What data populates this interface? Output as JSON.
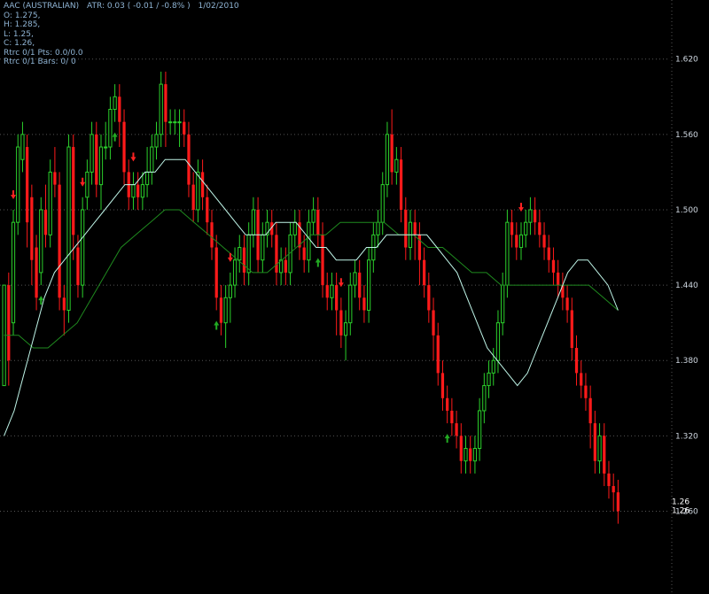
{
  "header": {
    "symbol": "AAC (AUSTRALIAN)",
    "atr": "ATR: 0.03 ( -0.01 / -0.8% )",
    "date": "1/02/2010",
    "open": "O: 1.275,",
    "high": "H: 1.285,",
    "low": "L: 1.25,",
    "close": "C: 1.26,",
    "rtrc_pts": "Rtrc 0/1 Pts: 0.0/0.0",
    "rtrc_bars": "Rtrc 0/1 Bars:  0/ 0"
  },
  "colors": {
    "background": "#000000",
    "up_candle": "#2bd12b",
    "down_candle": "#ff1a1a",
    "fast_ma": "#bff5e8",
    "slow_ma": "#1f8a1f",
    "grid": "#555555",
    "up_arrow": "#22aa22",
    "down_arrow": "#ff2222"
  },
  "chart_data": {
    "type": "candlestick",
    "title": "AAC (AUSTRALIAN)",
    "ylim": [
      1.23,
      1.66
    ],
    "y_ticks": [
      "1.620",
      "1.560",
      "1.500",
      "1.440",
      "1.380",
      "1.320",
      "1.260"
    ],
    "last_labels": [
      "1.26",
      "1.26"
    ],
    "grid": true,
    "candles": [
      [
        1.36,
        1.44,
        1.37,
        1.43
      ],
      [
        1.44,
        1.38,
        1.36,
        1.45
      ],
      [
        1.41,
        1.49,
        1.4,
        1.5
      ],
      [
        1.49,
        1.55,
        1.48,
        1.56
      ],
      [
        1.54,
        1.56,
        1.53,
        1.57
      ],
      [
        1.55,
        1.49,
        1.47,
        1.56
      ],
      [
        1.51,
        1.46,
        1.44,
        1.52
      ],
      [
        1.47,
        1.43,
        1.42,
        1.48
      ],
      [
        1.45,
        1.5,
        1.44,
        1.51
      ],
      [
        1.5,
        1.48,
        1.47,
        1.52
      ],
      [
        1.48,
        1.53,
        1.47,
        1.54
      ],
      [
        1.53,
        1.52,
        1.51,
        1.55
      ],
      [
        1.52,
        1.43,
        1.42,
        1.53
      ],
      [
        1.43,
        1.42,
        1.4,
        1.44
      ],
      [
        1.42,
        1.55,
        1.41,
        1.56
      ],
      [
        1.55,
        1.48,
        1.46,
        1.56
      ],
      [
        1.47,
        1.44,
        1.43,
        1.48
      ],
      [
        1.44,
        1.5,
        1.43,
        1.51
      ],
      [
        1.51,
        1.53,
        1.5,
        1.54
      ],
      [
        1.53,
        1.56,
        1.52,
        1.57
      ],
      [
        1.56,
        1.52,
        1.51,
        1.57
      ],
      [
        1.52,
        1.55,
        1.5,
        1.56
      ],
      [
        1.55,
        1.55,
        1.54,
        1.57
      ],
      [
        1.55,
        1.58,
        1.54,
        1.59
      ],
      [
        1.58,
        1.59,
        1.57,
        1.6
      ],
      [
        1.59,
        1.57,
        1.55,
        1.6
      ],
      [
        1.57,
        1.53,
        1.52,
        1.58
      ],
      [
        1.53,
        1.51,
        1.5,
        1.54
      ],
      [
        1.51,
        1.52,
        1.5,
        1.53
      ],
      [
        1.52,
        1.51,
        1.5,
        1.53
      ],
      [
        1.51,
        1.52,
        1.5,
        1.53
      ],
      [
        1.52,
        1.53,
        1.51,
        1.55
      ],
      [
        1.53,
        1.55,
        1.52,
        1.56
      ],
      [
        1.55,
        1.56,
        1.54,
        1.57
      ],
      [
        1.56,
        1.6,
        1.55,
        1.61
      ],
      [
        1.6,
        1.57,
        1.55,
        1.61
      ],
      [
        1.57,
        1.57,
        1.56,
        1.58
      ],
      [
        1.57,
        1.57,
        1.56,
        1.58
      ],
      [
        1.57,
        1.57,
        1.55,
        1.58
      ],
      [
        1.57,
        1.56,
        1.55,
        1.58
      ],
      [
        1.56,
        1.52,
        1.51,
        1.57
      ],
      [
        1.52,
        1.5,
        1.49,
        1.53
      ],
      [
        1.5,
        1.53,
        1.49,
        1.54
      ],
      [
        1.53,
        1.51,
        1.5,
        1.54
      ],
      [
        1.51,
        1.49,
        1.48,
        1.52
      ],
      [
        1.49,
        1.47,
        1.46,
        1.5
      ],
      [
        1.47,
        1.43,
        1.42,
        1.48
      ],
      [
        1.43,
        1.41,
        1.4,
        1.44
      ],
      [
        1.41,
        1.43,
        1.39,
        1.44
      ],
      [
        1.43,
        1.44,
        1.41,
        1.45
      ],
      [
        1.44,
        1.46,
        1.43,
        1.47
      ],
      [
        1.46,
        1.47,
        1.45,
        1.48
      ],
      [
        1.47,
        1.45,
        1.44,
        1.48
      ],
      [
        1.45,
        1.48,
        1.44,
        1.49
      ],
      [
        1.48,
        1.5,
        1.47,
        1.51
      ],
      [
        1.5,
        1.46,
        1.45,
        1.51
      ],
      [
        1.46,
        1.48,
        1.45,
        1.49
      ],
      [
        1.48,
        1.49,
        1.47,
        1.5
      ],
      [
        1.49,
        1.48,
        1.47,
        1.5
      ],
      [
        1.48,
        1.45,
        1.44,
        1.49
      ],
      [
        1.45,
        1.46,
        1.44,
        1.47
      ],
      [
        1.46,
        1.45,
        1.44,
        1.47
      ],
      [
        1.45,
        1.48,
        1.44,
        1.49
      ],
      [
        1.48,
        1.49,
        1.47,
        1.5
      ],
      [
        1.49,
        1.47,
        1.46,
        1.5
      ],
      [
        1.47,
        1.46,
        1.45,
        1.48
      ],
      [
        1.46,
        1.49,
        1.45,
        1.5
      ],
      [
        1.49,
        1.5,
        1.48,
        1.51
      ],
      [
        1.5,
        1.48,
        1.47,
        1.51
      ],
      [
        1.48,
        1.44,
        1.43,
        1.49
      ],
      [
        1.44,
        1.43,
        1.42,
        1.45
      ],
      [
        1.43,
        1.44,
        1.42,
        1.45
      ],
      [
        1.44,
        1.42,
        1.4,
        1.45
      ],
      [
        1.42,
        1.4,
        1.39,
        1.43
      ],
      [
        1.4,
        1.41,
        1.38,
        1.42
      ],
      [
        1.41,
        1.44,
        1.4,
        1.45
      ],
      [
        1.44,
        1.45,
        1.43,
        1.46
      ],
      [
        1.45,
        1.43,
        1.42,
        1.46
      ],
      [
        1.43,
        1.42,
        1.41,
        1.44
      ],
      [
        1.42,
        1.46,
        1.41,
        1.47
      ],
      [
        1.46,
        1.48,
        1.45,
        1.49
      ],
      [
        1.48,
        1.49,
        1.47,
        1.5
      ],
      [
        1.49,
        1.52,
        1.48,
        1.53
      ],
      [
        1.52,
        1.56,
        1.51,
        1.57
      ],
      [
        1.56,
        1.53,
        1.52,
        1.58
      ],
      [
        1.53,
        1.54,
        1.52,
        1.55
      ],
      [
        1.54,
        1.5,
        1.49,
        1.55
      ],
      [
        1.5,
        1.47,
        1.46,
        1.51
      ],
      [
        1.47,
        1.49,
        1.46,
        1.5
      ],
      [
        1.49,
        1.48,
        1.46,
        1.5
      ],
      [
        1.48,
        1.46,
        1.44,
        1.49
      ],
      [
        1.46,
        1.44,
        1.43,
        1.47
      ],
      [
        1.44,
        1.42,
        1.41,
        1.45
      ],
      [
        1.42,
        1.4,
        1.38,
        1.43
      ],
      [
        1.4,
        1.37,
        1.36,
        1.41
      ],
      [
        1.37,
        1.35,
        1.34,
        1.38
      ],
      [
        1.35,
        1.34,
        1.33,
        1.36
      ],
      [
        1.34,
        1.33,
        1.32,
        1.35
      ],
      [
        1.33,
        1.32,
        1.31,
        1.34
      ],
      [
        1.32,
        1.3,
        1.29,
        1.33
      ],
      [
        1.3,
        1.31,
        1.29,
        1.32
      ],
      [
        1.31,
        1.3,
        1.29,
        1.32
      ],
      [
        1.3,
        1.31,
        1.29,
        1.32
      ],
      [
        1.31,
        1.34,
        1.3,
        1.35
      ],
      [
        1.34,
        1.36,
        1.33,
        1.37
      ],
      [
        1.36,
        1.37,
        1.35,
        1.38
      ],
      [
        1.37,
        1.38,
        1.36,
        1.39
      ],
      [
        1.38,
        1.41,
        1.37,
        1.42
      ],
      [
        1.41,
        1.44,
        1.4,
        1.45
      ],
      [
        1.44,
        1.49,
        1.43,
        1.5
      ],
      [
        1.49,
        1.48,
        1.47,
        1.5
      ],
      [
        1.48,
        1.47,
        1.46,
        1.49
      ],
      [
        1.47,
        1.48,
        1.46,
        1.49
      ],
      [
        1.48,
        1.49,
        1.47,
        1.5
      ],
      [
        1.49,
        1.5,
        1.48,
        1.51
      ],
      [
        1.5,
        1.49,
        1.48,
        1.51
      ],
      [
        1.49,
        1.48,
        1.47,
        1.5
      ],
      [
        1.48,
        1.47,
        1.46,
        1.49
      ],
      [
        1.47,
        1.46,
        1.45,
        1.48
      ],
      [
        1.46,
        1.45,
        1.44,
        1.47
      ],
      [
        1.45,
        1.44,
        1.43,
        1.46
      ],
      [
        1.44,
        1.43,
        1.42,
        1.45
      ],
      [
        1.43,
        1.42,
        1.41,
        1.44
      ],
      [
        1.42,
        1.39,
        1.38,
        1.43
      ],
      [
        1.39,
        1.37,
        1.36,
        1.4
      ],
      [
        1.37,
        1.36,
        1.35,
        1.38
      ],
      [
        1.36,
        1.35,
        1.34,
        1.37
      ],
      [
        1.35,
        1.33,
        1.31,
        1.36
      ],
      [
        1.33,
        1.3,
        1.29,
        1.34
      ],
      [
        1.3,
        1.32,
        1.29,
        1.33
      ],
      [
        1.32,
        1.29,
        1.28,
        1.33
      ],
      [
        1.29,
        1.28,
        1.27,
        1.3
      ],
      [
        1.28,
        1.275,
        1.26,
        1.29
      ],
      [
        1.275,
        1.26,
        1.25,
        1.285
      ]
    ],
    "series": [
      {
        "values": [
          1.32,
          1.34,
          1.37,
          1.4,
          1.43,
          1.45,
          1.46,
          1.47,
          1.48,
          1.49,
          1.5,
          1.51,
          1.52,
          1.52,
          1.53,
          1.53,
          1.54,
          1.54,
          1.54,
          1.53,
          1.52,
          1.51,
          1.5,
          1.49,
          1.48,
          1.48,
          1.48,
          1.49,
          1.49,
          1.49,
          1.48,
          1.47,
          1.47,
          1.46,
          1.46,
          1.46,
          1.47,
          1.47,
          1.48,
          1.48,
          1.48,
          1.48,
          1.48,
          1.47,
          1.46,
          1.45,
          1.43,
          1.41,
          1.39,
          1.38,
          1.37,
          1.36,
          1.37,
          1.39,
          1.41,
          1.43,
          1.45,
          1.46,
          1.46,
          1.45,
          1.44,
          1.42
        ]
      },
      {
        "values": [
          1.4,
          1.4,
          1.39,
          1.39,
          1.4,
          1.41,
          1.43,
          1.45,
          1.47,
          1.48,
          1.49,
          1.5,
          1.5,
          1.49,
          1.48,
          1.47,
          1.46,
          1.45,
          1.45,
          1.46,
          1.47,
          1.48,
          1.48,
          1.49,
          1.49,
          1.49,
          1.49,
          1.48,
          1.48,
          1.47,
          1.47,
          1.46,
          1.45,
          1.45,
          1.44,
          1.44,
          1.44,
          1.44,
          1.44,
          1.44,
          1.44,
          1.43,
          1.42
        ]
      }
    ],
    "up_arrows_at": [
      8,
      24,
      46,
      68,
      96
    ],
    "down_arrows_at": [
      2,
      17,
      28,
      49,
      73,
      112
    ]
  }
}
